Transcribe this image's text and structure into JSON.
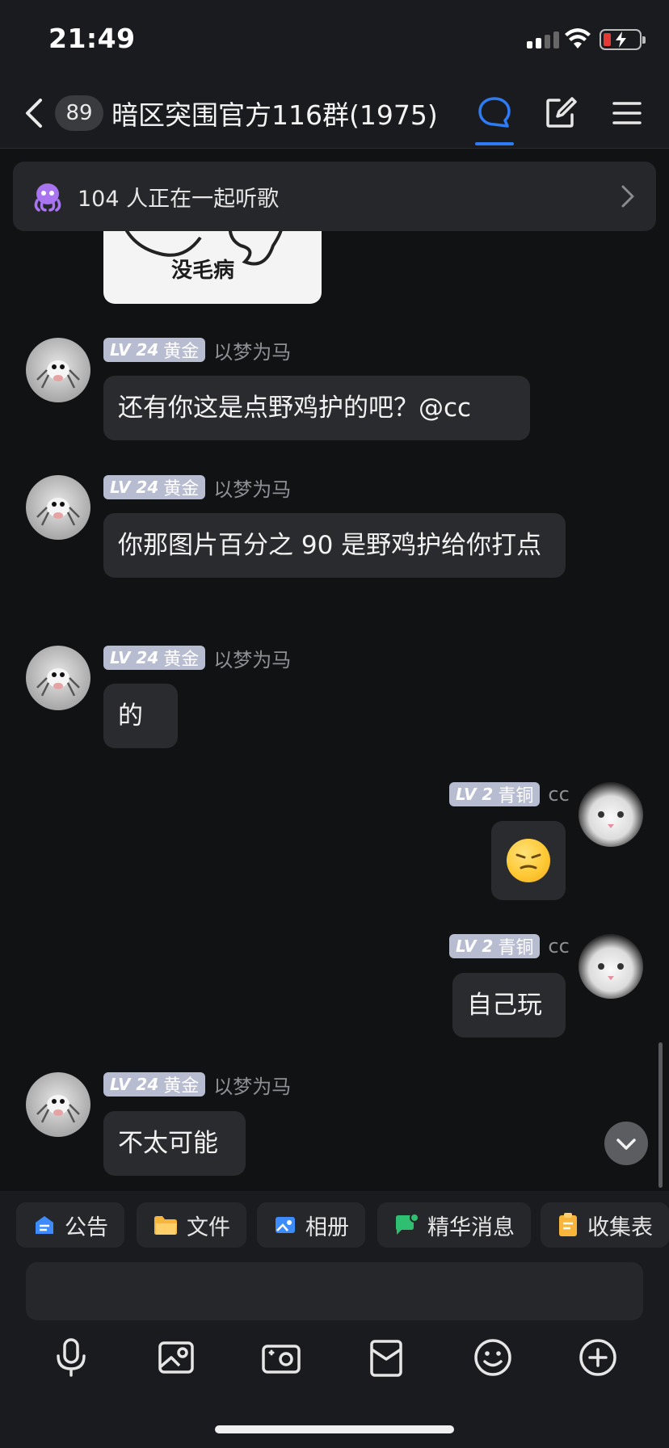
{
  "status": {
    "time": "21:49"
  },
  "nav": {
    "unread_count": "89",
    "group_title": "暗区突围官方116群(1975)"
  },
  "banner": {
    "text": "104 人正在一起听歌"
  },
  "sticker": {
    "text": "没毛病"
  },
  "messages": [
    {
      "level": "LV 24",
      "rank": "黄金",
      "sender": "以梦为马",
      "text": "还有你这是点野鸡护的吧？@cc"
    },
    {
      "level": "LV 24",
      "rank": "黄金",
      "sender": "以梦为马",
      "text": "你那图片百分之 90 是野鸡护给你打点"
    },
    {
      "level": "LV 24",
      "rank": "黄金",
      "sender": "以梦为马",
      "text": "的"
    },
    {
      "level": "LV 2",
      "rank": "青铜",
      "sender": "cc",
      "text": ""
    },
    {
      "level": "LV 2",
      "rank": "青铜",
      "sender": "cc",
      "text": "自己玩"
    },
    {
      "level": "LV 24",
      "rank": "黄金",
      "sender": "以梦为马",
      "text": "不太可能"
    }
  ],
  "chips": [
    "公告",
    "文件",
    "相册",
    "精华消息",
    "收集表"
  ],
  "input": {
    "placeholder": ""
  },
  "colors": {
    "accent": "#2d7cf6",
    "bubble": "#2a2b2f",
    "background": "#111214",
    "level_tag": "#b7bcd0"
  }
}
